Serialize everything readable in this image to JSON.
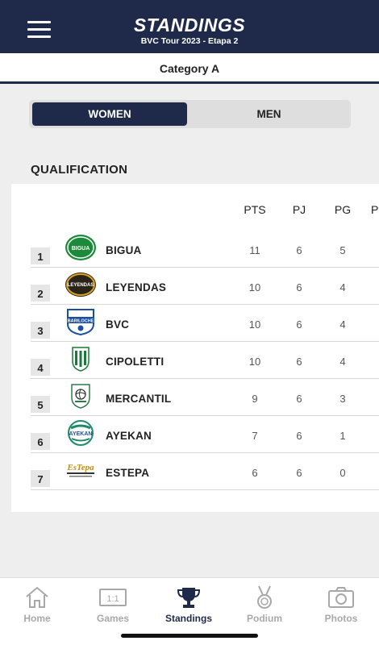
{
  "header": {
    "title": "STANDINGS",
    "subtitle": "BVC Tour 2023 - Etapa 2",
    "menu_icon": "hamburger-menu-icon"
  },
  "category": {
    "label": "Category A"
  },
  "tabs": [
    {
      "label": "WOMEN",
      "selected": true
    },
    {
      "label": "MEN",
      "selected": false
    }
  ],
  "section": {
    "title": "QUALIFICATION"
  },
  "table": {
    "columns": [
      "PTS",
      "PJ",
      "PG"
    ],
    "rows": [
      {
        "pos": "1",
        "team": "BIGUA",
        "pts": "11",
        "pj": "6",
        "pg": "5",
        "logo_color": "#1b8a3a"
      },
      {
        "pos": "2",
        "team": "LEYENDAS",
        "pts": "10",
        "pj": "6",
        "pg": "4",
        "logo_color": "#2a2418"
      },
      {
        "pos": "3",
        "team": "BVC",
        "pts": "10",
        "pj": "6",
        "pg": "4",
        "logo_color": "#1d4fa0"
      },
      {
        "pos": "4",
        "team": "CIPOLETTI",
        "pts": "10",
        "pj": "6",
        "pg": "4",
        "logo_color": "#1b7a3a"
      },
      {
        "pos": "5",
        "team": "MERCANTIL",
        "pts": "9",
        "pj": "6",
        "pg": "3",
        "logo_color": "#2e7a4a"
      },
      {
        "pos": "6",
        "team": "AYEKAN",
        "pts": "7",
        "pj": "6",
        "pg": "1",
        "logo_color": "#1e8a6a"
      },
      {
        "pos": "7",
        "team": "ESTEPA",
        "pts": "6",
        "pj": "6",
        "pg": "0",
        "logo_color": "#c98f10"
      }
    ]
  },
  "nav": [
    {
      "label": "Home",
      "icon": "home-icon",
      "active": false
    },
    {
      "label": "Games",
      "icon": "scoreboard-icon",
      "active": false
    },
    {
      "label": "Standings",
      "icon": "trophy-icon",
      "active": true
    },
    {
      "label": "Podium",
      "icon": "medal-icon",
      "active": false
    },
    {
      "label": "Photos",
      "icon": "camera-icon",
      "active": false
    }
  ],
  "colors": {
    "primary": "#1f2a4a",
    "inactive": "#a8a8a8",
    "background": "#eeeeee"
  }
}
